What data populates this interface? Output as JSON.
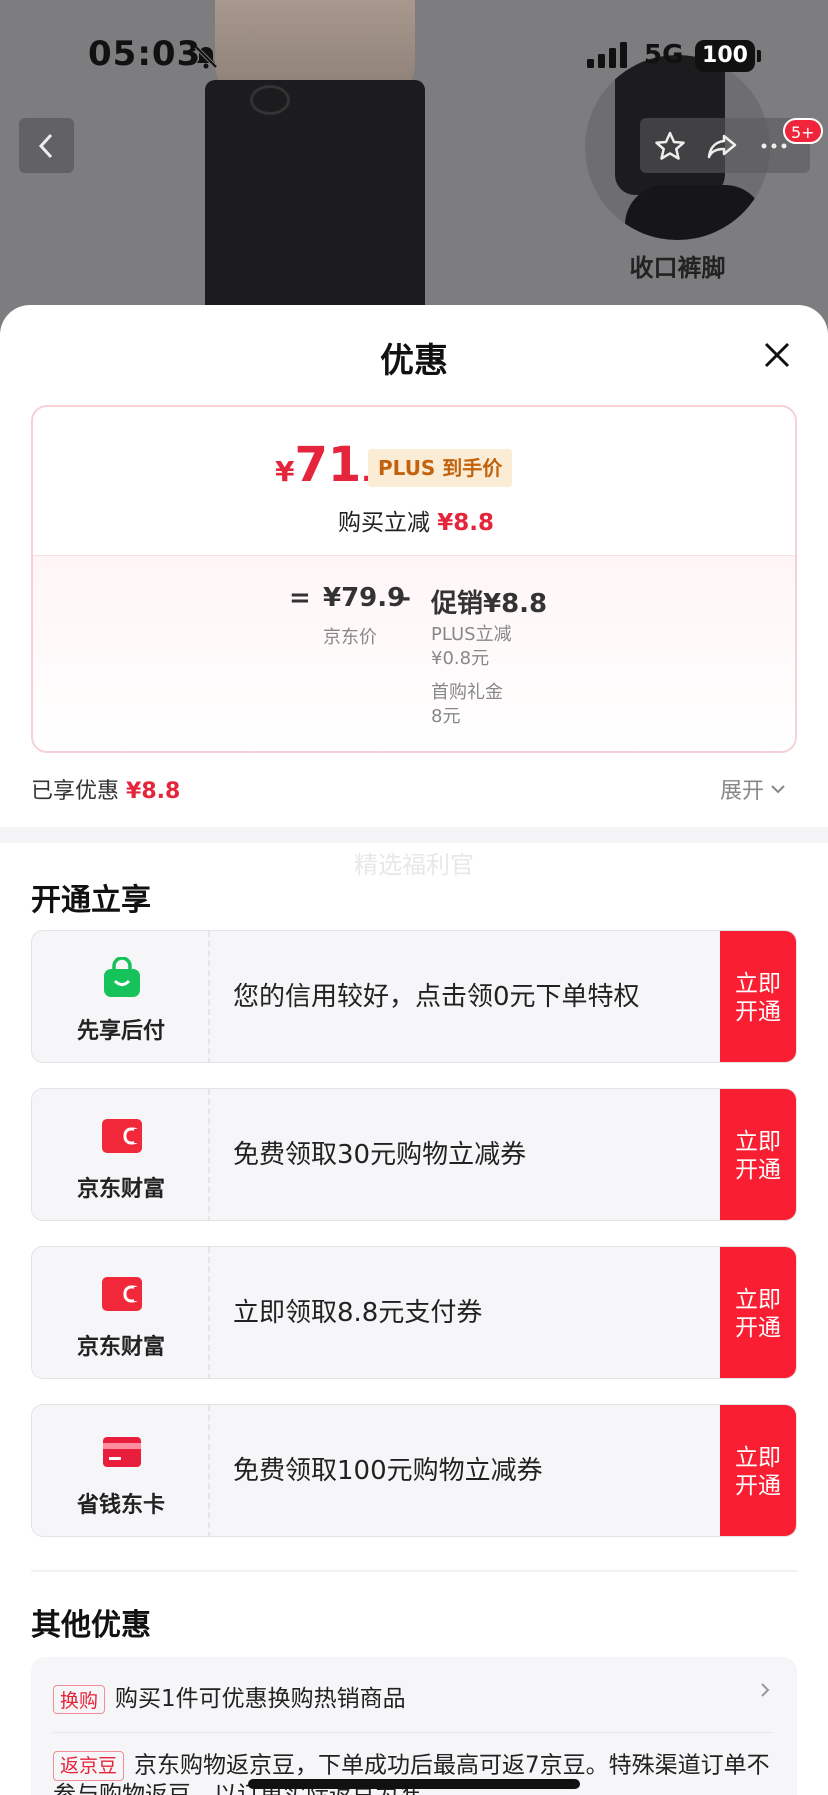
{
  "status": {
    "time": "05:03",
    "network": "5G",
    "battery": "100"
  },
  "hero": {
    "thumb_label": "收口裤脚",
    "badge": "5+"
  },
  "sheet": {
    "title": "优惠",
    "price_card": {
      "currency": "¥",
      "price_int": "71",
      "price_dec": ".1",
      "plus_tag": "PLUS 到手价",
      "reduce_label": "购买立减",
      "reduce_value": "¥8.8",
      "eq": "=",
      "jd_price": "¥79.9",
      "jd_label": "京东价",
      "minus": "–",
      "promo": "促销¥8.8",
      "sub1_line1": "PLUS立减",
      "sub1_line2": "¥0.8元",
      "sub2_line1": "首购礼金",
      "sub2_line2": "8元"
    },
    "enjoyed_label": "已享优惠",
    "enjoyed_value": "¥8.8",
    "expand_label": "展开",
    "faint_text": "精选福利官",
    "open_section_title": "开通立享",
    "offers": [
      {
        "name": "先享后付",
        "desc": "您的信用较好，点击领0元下单特权",
        "cta": "立即开通",
        "icon": "green-bag-icon",
        "color": "#16c35a"
      },
      {
        "name": "京东财富",
        "desc": "免费领取30元购物立减券",
        "cta": "立即开通",
        "icon": "red-wallet-icon",
        "color": "#f0283a"
      },
      {
        "name": "京东财富",
        "desc": "立即领取8.8元支付券",
        "cta": "立即开通",
        "icon": "red-wallet-icon",
        "color": "#f0283a"
      },
      {
        "name": "省钱东卡",
        "desc": "免费领取100元购物立减券",
        "cta": "立即开通",
        "icon": "red-card-icon",
        "color": "#e91e3c"
      }
    ],
    "other_section_title": "其他优惠",
    "others": [
      {
        "tag": "换购",
        "text": "购买1件可优惠换购热销商品"
      },
      {
        "tag": "返京豆",
        "text": "京东购物返京豆，下单成功后最高可返7京豆。特殊渠道订单不参与购物返豆，以订单实际返豆为准"
      }
    ]
  }
}
